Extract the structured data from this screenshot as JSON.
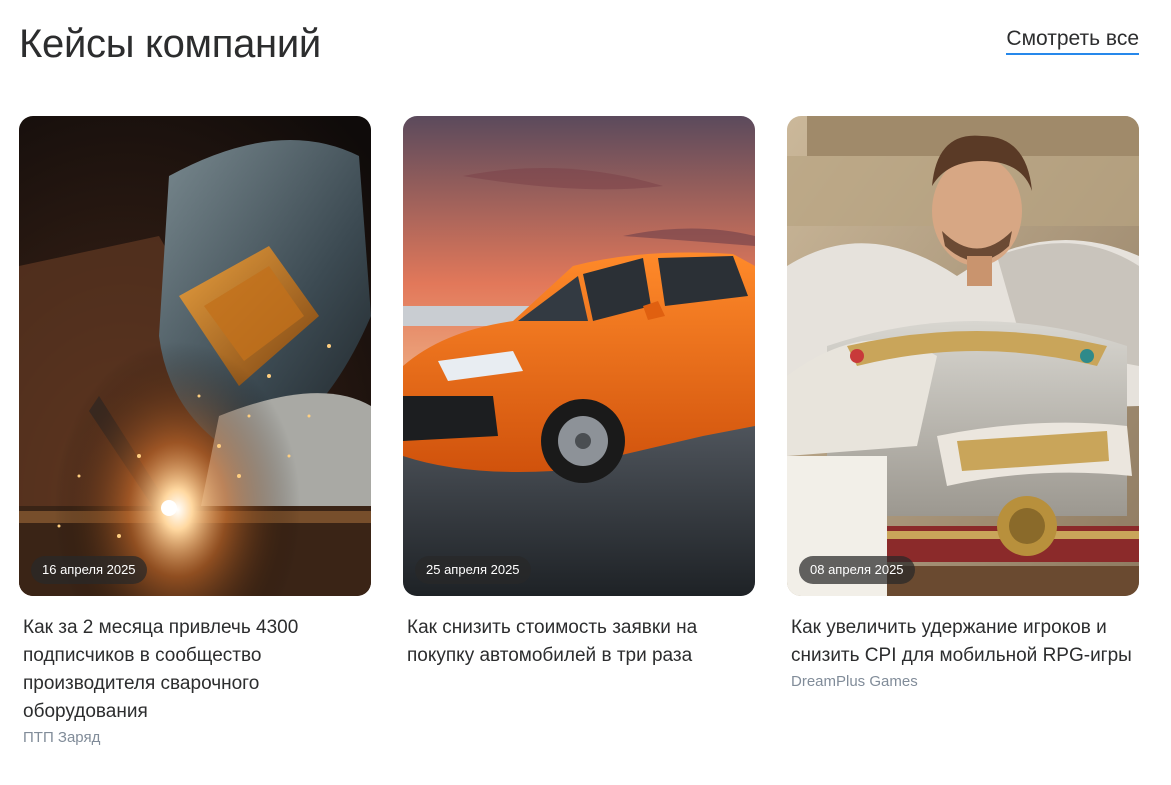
{
  "header": {
    "title": "Кейсы компаний",
    "see_all_label": "Смотреть все"
  },
  "cards": [
    {
      "date": "16 апреля 2025",
      "title": "Как за 2 месяца привлечь 4300 подписчиков в сообщество производителя сварочного оборудования",
      "company": "ПТП Заряд",
      "image": "welder-photo"
    },
    {
      "date": "25 апреля 2025",
      "title": "Как снизить стоимость заявки на покупку автомобилей в три раза",
      "company": "",
      "image": "orange-car-photo"
    },
    {
      "date": "08 апреля 2025",
      "title": "Как увеличить удержание игроков и снизить CPI для мобильной RPG-игры",
      "company": "DreamPlus Games",
      "image": "fantasy-warrior-art"
    }
  ],
  "colors": {
    "link_underline": "#2688eb",
    "text": "#2c2d2e",
    "secondary_text": "#818c99"
  }
}
